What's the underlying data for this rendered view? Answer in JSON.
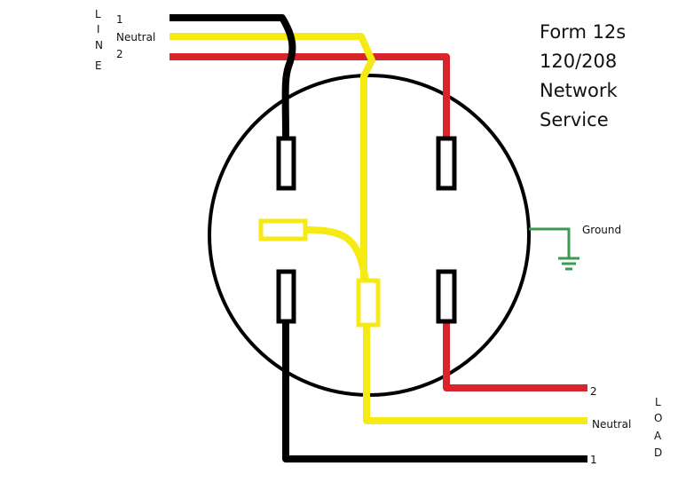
{
  "title_lines": [
    "Form 12s",
    "120/208",
    "Network",
    "Service"
  ],
  "line_side": {
    "vertical_label": [
      "L",
      "I",
      "N",
      "E"
    ],
    "terminals": [
      "1",
      "Neutral",
      "2"
    ]
  },
  "load_side": {
    "vertical_label": [
      "L",
      "O",
      "A",
      "D"
    ],
    "terminals": [
      "2",
      "Neutral",
      "1"
    ]
  },
  "ground_label": "Ground",
  "colors": {
    "line1": "#000000",
    "neutral": "#f5ea14",
    "line2": "#d9242b",
    "ground": "#3a9a52",
    "meter_outline": "#000000"
  }
}
